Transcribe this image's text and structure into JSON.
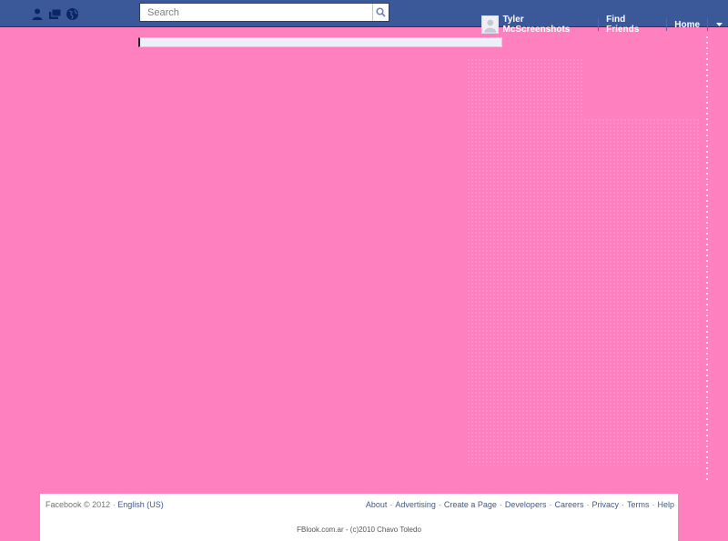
{
  "colors": {
    "background": "#ff80bf",
    "topbar": "#3b5998",
    "link": "#3b5998"
  },
  "jewels": [
    {
      "icon": "friend-requests-icon"
    },
    {
      "icon": "messages-icon"
    },
    {
      "icon": "notifications-globe-icon"
    }
  ],
  "search": {
    "placeholder": "Search",
    "icon": "search-icon"
  },
  "nav": {
    "user_name": "Tyler McScreenshots",
    "find_friends": "Find Friends",
    "home": "Home",
    "menu_icon": "caret-down-icon"
  },
  "footer": {
    "copyright": "Facebook © 2012",
    "separator": " · ",
    "language": "English (US)",
    "links": [
      "About",
      "Advertising",
      "Create a Page",
      "Developers",
      "Careers",
      "Privacy",
      "Terms",
      "Help"
    ],
    "credit": "FBlook.com.ar - (c)2010 Chavo Toledo"
  }
}
